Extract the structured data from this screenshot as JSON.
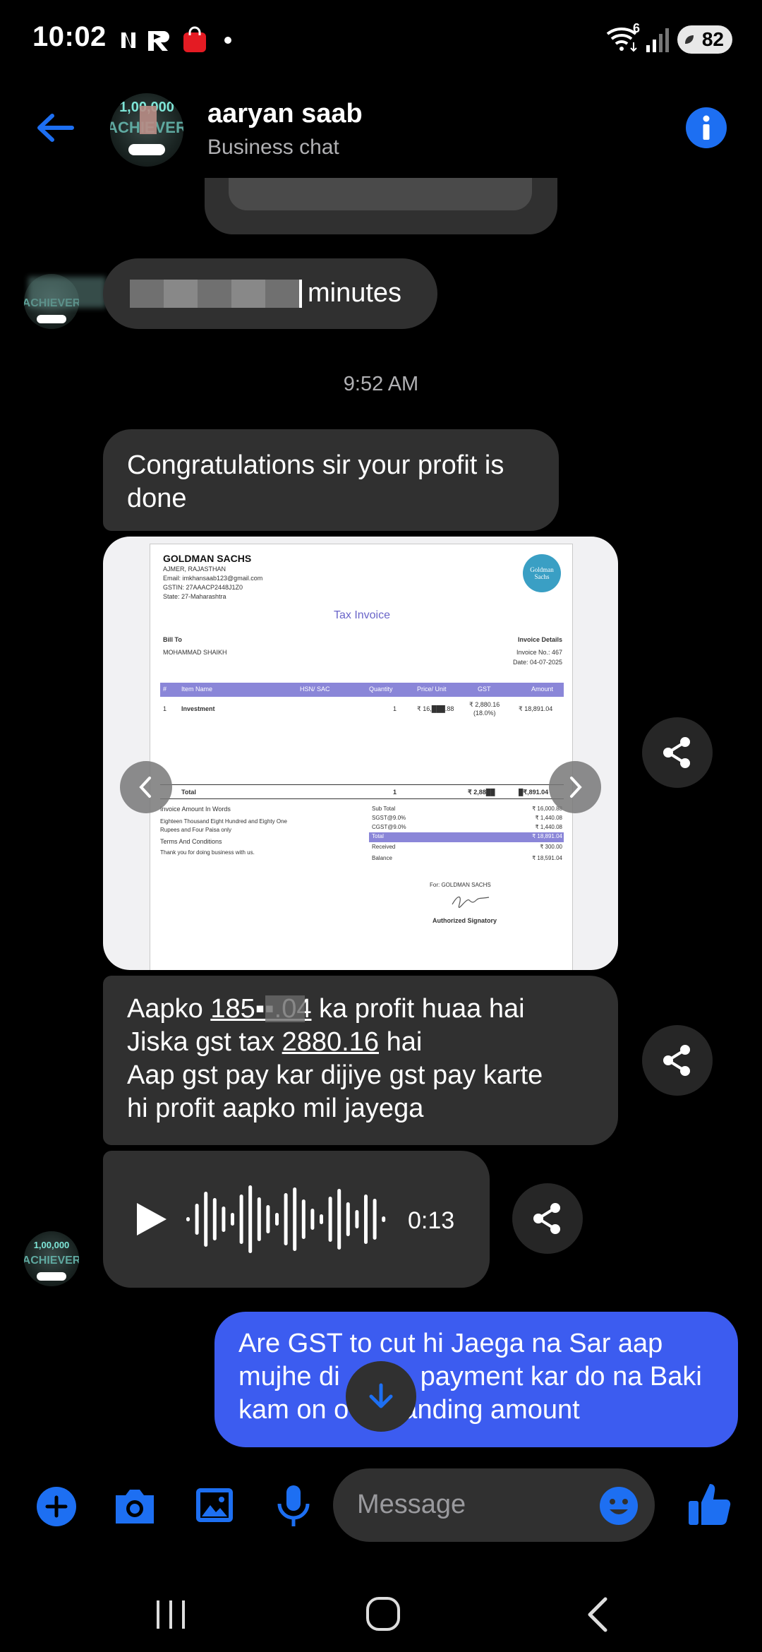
{
  "status_bar": {
    "time": "10:02",
    "battery": "82",
    "network_type": "6"
  },
  "header": {
    "contact_name": "aaryan saab",
    "subtitle": "Business chat"
  },
  "messages": {
    "partial_top": "",
    "minutes_text": "minutes",
    "timestamp": "9:52 AM",
    "congrats": "Congratulations sir your profit is done",
    "profit_line1_a": "Aapko ",
    "profit_amount": "185▪▪.04",
    "profit_line1_b": " ka profit huaa hai",
    "profit_line2_a": "Jiska gst tax ",
    "gst_amount": "2880.16",
    "profit_line2_b": " hai",
    "profit_line3": "Aap gst pay kar dijiye gst pay karte",
    "profit_line4": "hi profit aapko mil jayega",
    "voice_duration": "0:13",
    "outgoing_line1": "Are GST to cut hi Jaega na Sar aap",
    "outgoing_line2": "mujhe di   payment kar do na Baki",
    "outgoing_line3": "kam on o  anding amount"
  },
  "invoice": {
    "company": "GOLDMAN SACHS",
    "city": "AJMER, RAJASTHAN",
    "email": "Email: imkhansaab123@gmail.com",
    "gstin": "GSTIN: 27AAACP2448J1Z0",
    "state": "State: 27-Maharashtra",
    "logo_text": "Goldman Sachs",
    "title": "Tax Invoice",
    "bill_to": "Bill To",
    "customer": "MOHAMMAD SHAIKH",
    "details_label": "Invoice Details",
    "invoice_no": "Invoice No.: 467",
    "date": "Date: 04-07-2025",
    "col_hash": "#",
    "col_item": "Item Name",
    "col_hsn": "HSN/ SAC",
    "col_qty": "Quantity",
    "col_price": "Price/ Unit",
    "col_gst": "GST",
    "col_amount": "Amount",
    "row_no": "1",
    "row_item": "Investment",
    "row_qty": "1",
    "row_price": "₹ 16,███.88",
    "row_gst": "₹ 2,880.16",
    "row_gst_pct": "(18.0%)",
    "row_amount": "₹ 18,891.04",
    "total_label": "Total",
    "total_qty": "1",
    "total_gst": "₹ 2,88██",
    "total_amount": "█₹,891.04",
    "words_label": "Invoice Amount In Words",
    "words_1": "Eighteen Thousand Eight Hundred and Eighty One",
    "words_2": "Rupees and Four Paisa only",
    "terms_label": "Terms And Conditions",
    "terms_text": "Thank you for doing business with us.",
    "sub_total_l": "Sub Total",
    "sub_total_v": "₹ 16,000.88",
    "sgst_l": "SGST@9.0%",
    "sgst_v": "₹ 1,440.08",
    "cgst_l": "CGST@9.0%",
    "cgst_v": "₹ 1,440.08",
    "total2_l": "Total",
    "total2_v": "₹ 18,891.04",
    "received_l": "Received",
    "received_v": "₹ 300.00",
    "balance_l": "Balance",
    "balance_v": "₹ 18,591.04",
    "for_label": "For: GOLDMAN SACHS",
    "signatory": "Authorized Signatory"
  },
  "composer": {
    "placeholder": "Message"
  },
  "colors": {
    "accent": "#1d6ff2",
    "outgoing_bubble": "#3c5cf0",
    "incoming_bubble": "#303030"
  }
}
